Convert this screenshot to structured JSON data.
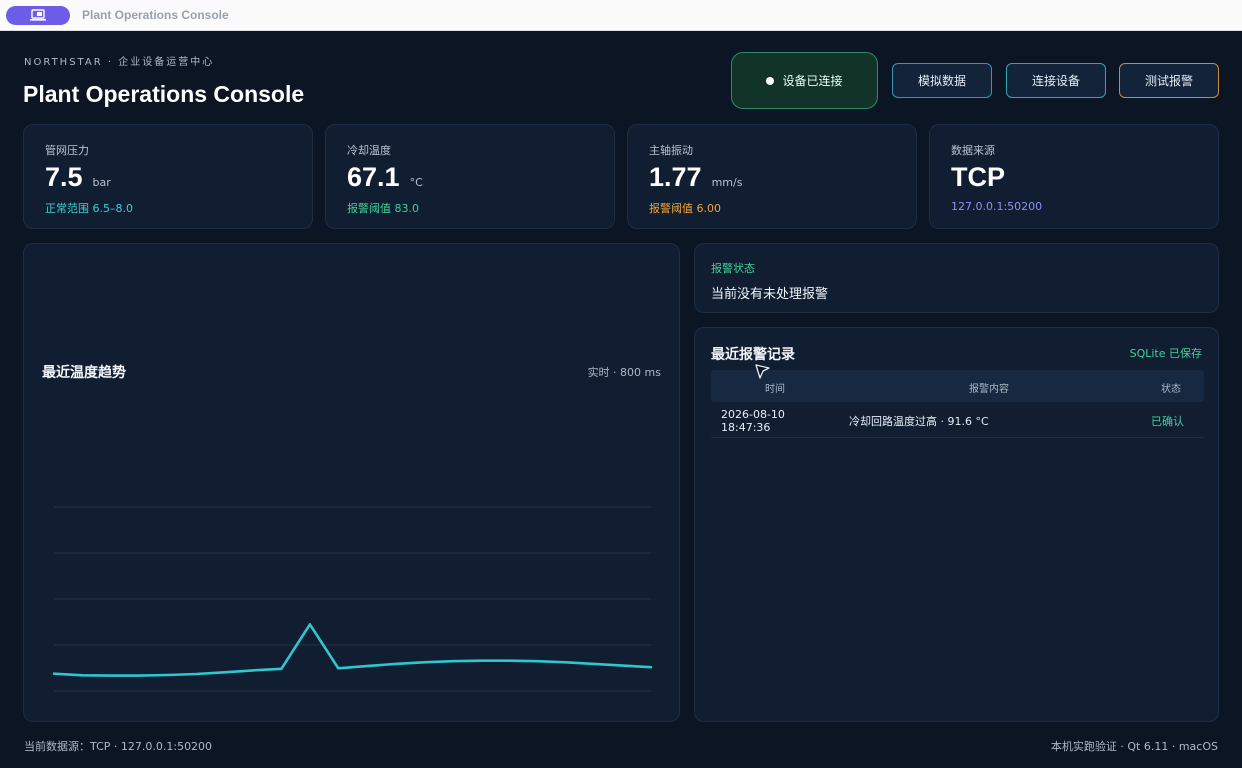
{
  "window": {
    "title": "Plant Operations Console"
  },
  "header": {
    "brand": "NORTHSTAR · 企业设备运营中心",
    "title": "Plant Operations Console",
    "status_label": "设备已连接",
    "buttons": {
      "simulate": "模拟数据",
      "connect": "连接设备",
      "test_alarm": "测试报警"
    }
  },
  "metrics": [
    {
      "label": "管网压力",
      "value": "7.5",
      "unit": "bar",
      "sub": "正常范围 6.5–8.0",
      "sub_color": "#3fd0d6"
    },
    {
      "label": "冷却温度",
      "value": "67.1",
      "unit": "°C",
      "sub": "报警阈值 83.0",
      "sub_color": "#3fd29a"
    },
    {
      "label": "主轴振动",
      "value": "1.77",
      "unit": "mm/s",
      "sub": "报警阈值 6.00",
      "sub_color": "#f2a33a"
    },
    {
      "label": "数据来源",
      "value": "TCP",
      "unit": "",
      "sub": "127.0.0.1:50200",
      "sub_color": "#8a93f5"
    }
  ],
  "trend": {
    "title": "最近温度趋势",
    "rate": "实时 · 800 ms",
    "line_color": "#2fc6d0"
  },
  "chart_data": {
    "type": "line",
    "title": "最近温度趋势",
    "xlabel": "",
    "ylabel": "",
    "grid": true,
    "ylim": [
      64,
      98
    ],
    "series": [
      {
        "values": [
          67.2,
          66.9,
          66.85,
          66.85,
          66.95,
          67.15,
          67.45,
          67.8,
          68.1,
          76.3,
          68.2,
          68.6,
          69.0,
          69.3,
          69.5,
          69.6,
          69.6,
          69.5,
          69.3,
          69.0,
          68.7,
          68.4
        ]
      }
    ]
  },
  "alarm": {
    "label": "报警状态",
    "message": "当前没有未处理报警"
  },
  "log": {
    "title": "最近报警记录",
    "saved": "SQLite 已保存",
    "columns": [
      "时间",
      "报警内容",
      "状态"
    ],
    "rows": [
      {
        "time_date": "2026-08-10",
        "time_clock": "18:47:36",
        "message": "冷却回路温度过高 · 91.6 °C",
        "state": "已确认"
      }
    ]
  },
  "footer": {
    "left": "当前数据源：TCP · 127.0.0.1:50200",
    "right": "本机实跑验证 · Qt 6.11 · macOS"
  }
}
